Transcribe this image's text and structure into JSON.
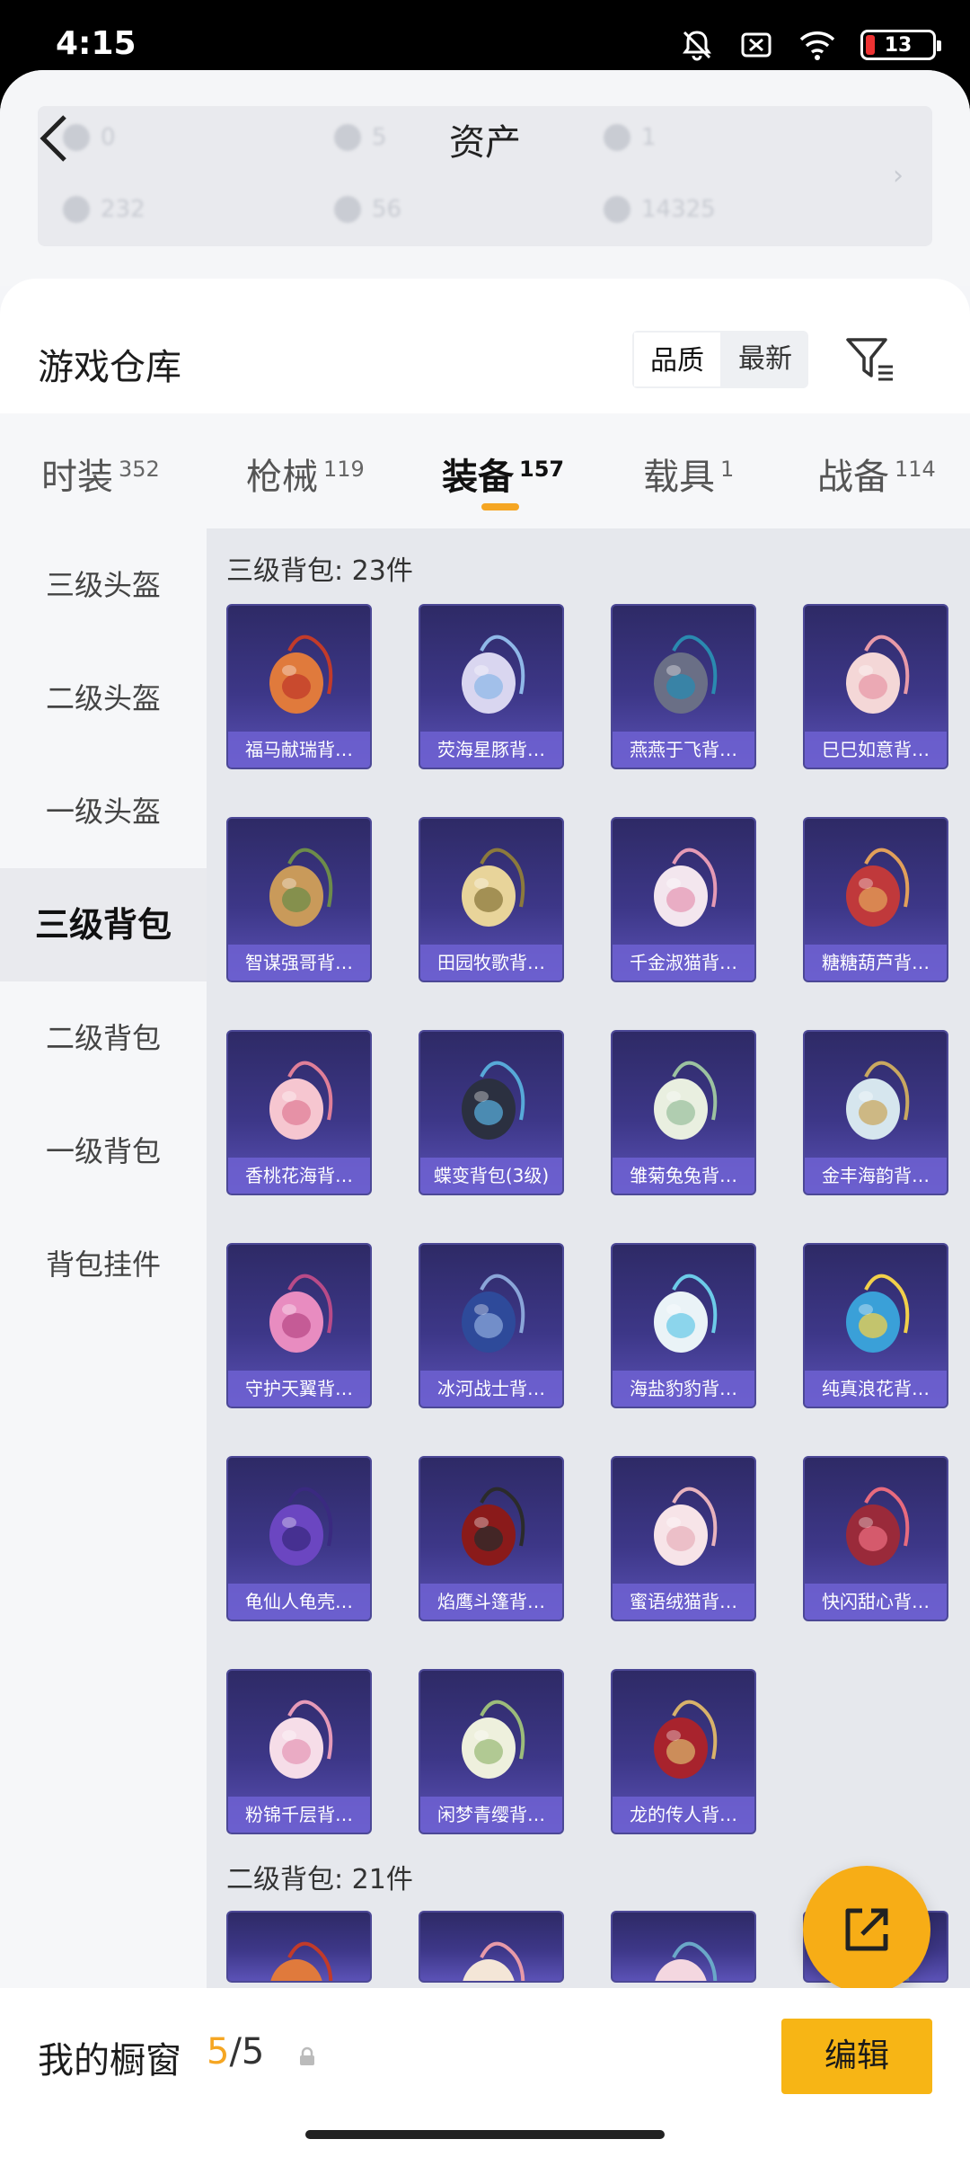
{
  "status_bar": {
    "time": "4:15",
    "battery": "13"
  },
  "asset": {
    "title": "资产",
    "values_row1": [
      "0",
      "5",
      "1"
    ],
    "values_row2": [
      "232",
      "56",
      "14325"
    ]
  },
  "warehouse": {
    "title": "游戏仓库",
    "sort_options": [
      "品质",
      "最新"
    ],
    "tabs": [
      {
        "label": "时装",
        "count": "352"
      },
      {
        "label": "枪械",
        "count": "119"
      },
      {
        "label": "装备",
        "count": "157"
      },
      {
        "label": "载具",
        "count": "1"
      },
      {
        "label": "战备",
        "count": "114"
      }
    ],
    "sidebar": [
      "三级头盔",
      "二级头盔",
      "一级头盔",
      "三级背包",
      "二级背包",
      "一级背包",
      "背包挂件"
    ],
    "sections": [
      {
        "title": "三级背包: 23件",
        "items": [
          "福马献瑞背…",
          "荧海星豚背…",
          "燕燕于飞背…",
          "巳巳如意背…",
          "智谋强哥背…",
          "田园牧歌背…",
          "千金淑猫背…",
          "糖糖葫芦背…",
          "香桃花海背…",
          "蝶变背包(3级)",
          "雏菊兔兔背…",
          "金丰海韵背…",
          "守护天翼背…",
          "冰河战士背…",
          "海盐豹豹背…",
          "纯真浪花背…",
          "龟仙人龟壳…",
          "焰鹰斗篷背…",
          "蜜语绒猫背…",
          "快闪甜心背…",
          "粉锦千层背…",
          "闲梦青缨背…",
          "龙的传人背…"
        ]
      },
      {
        "title": "二级背包: 21件"
      }
    ]
  },
  "showcase": {
    "title": "我的橱窗",
    "used": "5",
    "total": "/5",
    "edit_label": "编辑"
  },
  "colors": {
    "accent": "#f5a623",
    "card_bg": "#3d3788"
  }
}
